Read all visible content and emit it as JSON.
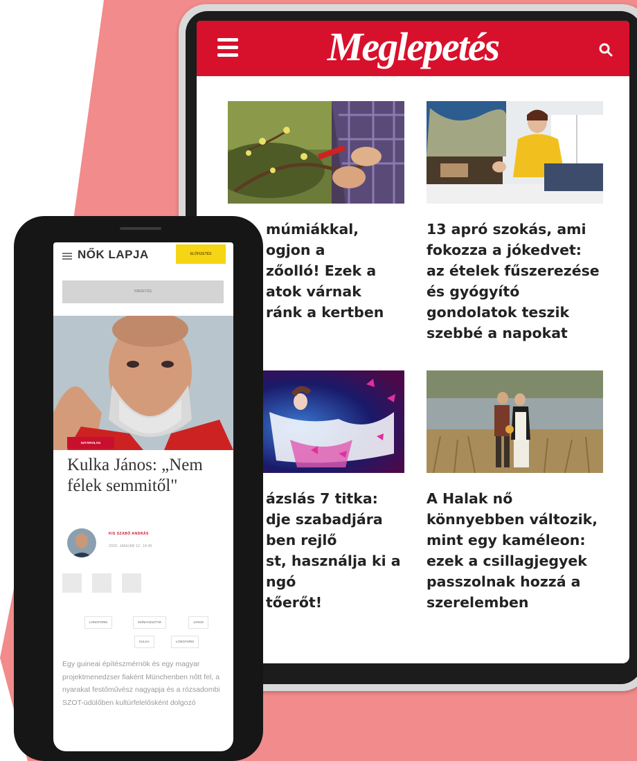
{
  "colors": {
    "background_pink": "#f28b8b",
    "brand_red": "#d7112c",
    "subscribe_yellow": "#f5d514"
  },
  "tablet": {
    "logo": "Meglepetés",
    "menu_icon": "hamburger-icon",
    "search_icon": "search-icon",
    "articles": [
      {
        "title": "múmiákkal,\nogjon a\nzőolló! Ezek a\natok várnak\nránk a kertben"
      },
      {
        "title": "13 apró szokás, ami fokozza a jókedvet: az ételek fűszerezése és gyógyító gondolatok teszik szebbé a napokat"
      },
      {
        "title": "ázslás 7 titka:\ndje szabadjára\nben rejlő\nst, használja ki a\nngó\ntőerőt!"
      },
      {
        "title": "A Halak nő könnyebben változik, mint egy kaméleon: ezek a csillagjegyek passzolnak hozzá a szerelemben"
      }
    ]
  },
  "phone": {
    "logo": "NŐK LAPJA",
    "subscribe_label": "ELŐFIZETÉS",
    "ad_label": "HIRDETÉS",
    "category": "SZTÁRVILÁG",
    "article_title": "Kulka János: „Nem félek semmitől\"",
    "author": "KIS SZABÓ ANDRÁS",
    "date": "2020. JANUÁR 12. 10:45",
    "share_icons": [
      "facebook-icon",
      "email-icon",
      "link-icon"
    ],
    "tags": [
      "LONGFORM",
      "SZÍNHÁZSZTÁR",
      "JANOS",
      "KULKA",
      "LONGFORM"
    ],
    "body": "Egy guineai építészmérnök és egy magyar projektmenedzser fiaként Münchenben nőtt fel, a nyarakat festőművész nagyapja és a rózsadombi SZOT-üdülőben kultúrfelelősként dolgozó"
  }
}
